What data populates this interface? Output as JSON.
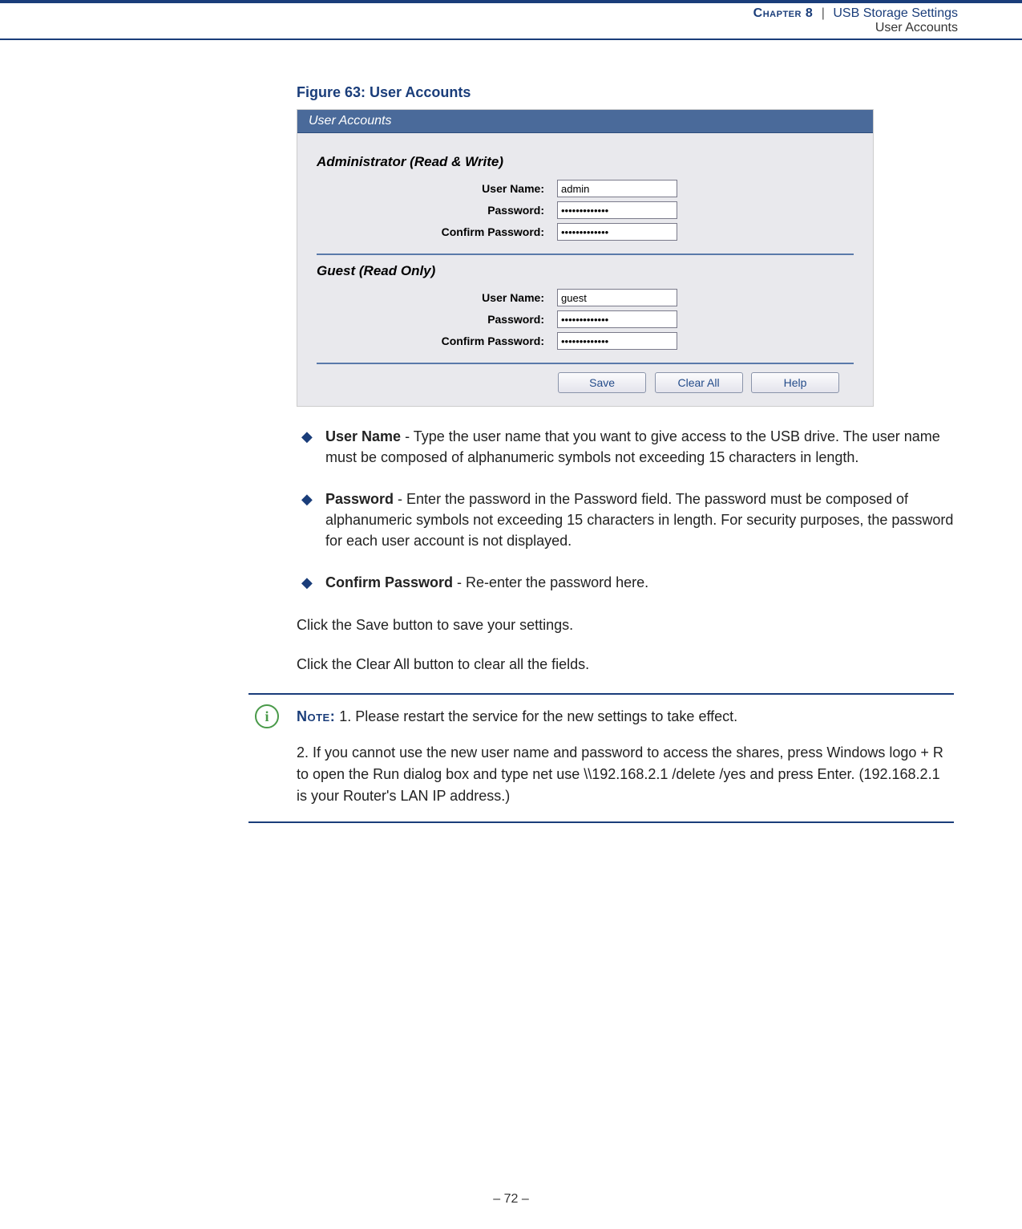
{
  "header": {
    "chapter": "Chapter 8",
    "separator": "|",
    "title": "USB Storage Settings",
    "subtitle": "User Accounts"
  },
  "figure_caption": "Figure 63:  User Accounts",
  "panel": {
    "title": "User Accounts",
    "admin_section": "Administrator   (Read & Write)",
    "guest_section": "Guest   (Read Only)",
    "labels": {
      "username": "User Name:",
      "password": "Password:",
      "confirm": "Confirm Password:"
    },
    "admin": {
      "username": "admin",
      "password": "•••••••••••••",
      "confirm": "•••••••••••••"
    },
    "guest": {
      "username": "guest",
      "password": "•••••••••••••",
      "confirm": "•••••••••••••"
    },
    "buttons": {
      "save": "Save",
      "clear": "Clear All",
      "help": "Help"
    }
  },
  "bullets": [
    {
      "strong": "User Name",
      "rest": " - Type the user name that you want to give access to the USB drive. The user name must be composed of alphanumeric symbols not exceeding 15 characters in length."
    },
    {
      "strong": "Password",
      "rest": " - Enter the password in the Password field. The password must be composed of alphanumeric symbols not exceeding 15 characters in length. For security purposes, the password for each user account is not displayed."
    },
    {
      "strong": "Confirm Password",
      "rest": " - Re-enter the password here."
    }
  ],
  "paragraphs": {
    "save": "Click the Save button to save your settings.",
    "clear": "Click the Clear All button to clear all the fields."
  },
  "note": {
    "label": "Note:",
    "p1": " 1. Please restart the service for the new settings to take effect.",
    "p2": "2. If you cannot use the new user name and password to access the shares, press Windows logo + R to open the Run dialog box and type net use \\\\192.168.2.1 /delete /yes and press Enter. (192.168.2.1 is your Router's LAN IP address.)"
  },
  "page_number": "–  72  –"
}
